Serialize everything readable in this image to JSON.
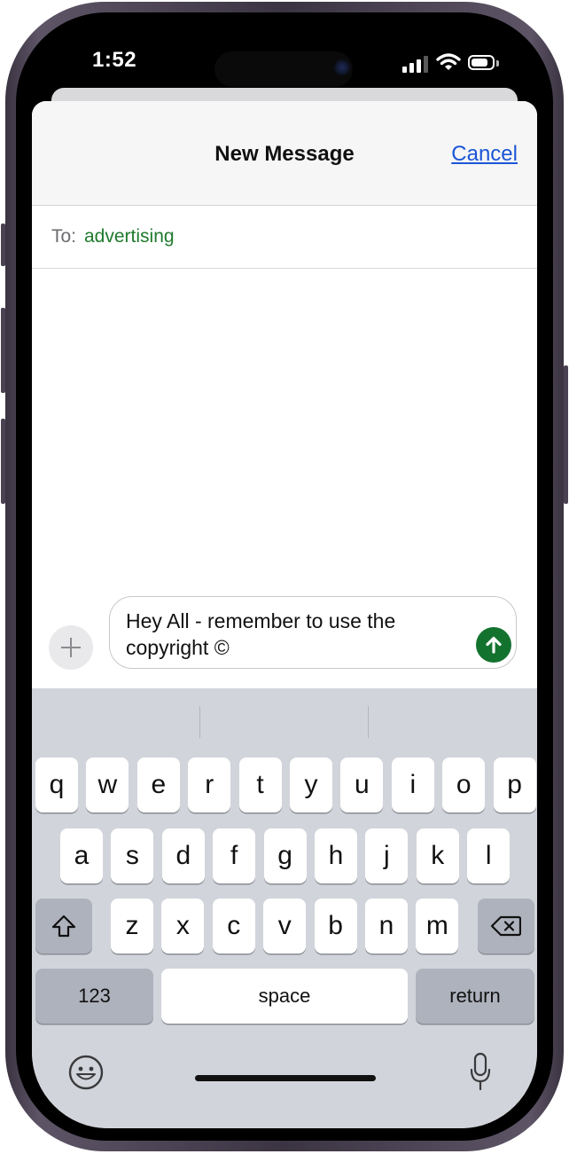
{
  "status_bar": {
    "time": "1:52",
    "signal_bars": 4,
    "signal_bars_active": 3,
    "battery_level": 0.8
  },
  "nav": {
    "title": "New Message",
    "cancel_label": "Cancel"
  },
  "recipient": {
    "label": "To:",
    "value": "advertising"
  },
  "compose": {
    "plus_icon": "plus-icon",
    "message_text": "Hey All - remember to use the copyright ©",
    "send_icon": "arrow-up-icon"
  },
  "keyboard": {
    "row1": [
      "q",
      "w",
      "e",
      "r",
      "t",
      "y",
      "u",
      "i",
      "o",
      "p"
    ],
    "row2": [
      "a",
      "s",
      "d",
      "f",
      "g",
      "h",
      "j",
      "k",
      "l"
    ],
    "row3": [
      "z",
      "x",
      "c",
      "v",
      "b",
      "n",
      "m"
    ],
    "shift_icon": "shift-icon",
    "delete_icon": "delete-icon",
    "numbers_label": "123",
    "space_label": "space",
    "return_label": "return",
    "emoji_icon": "emoji-icon",
    "mic_icon": "microphone-icon"
  },
  "colors": {
    "accent_green": "#14722f",
    "recipient_green": "#1f7a2e",
    "link_blue": "#1a55d6",
    "keyboard_bg": "#d2d4db"
  }
}
